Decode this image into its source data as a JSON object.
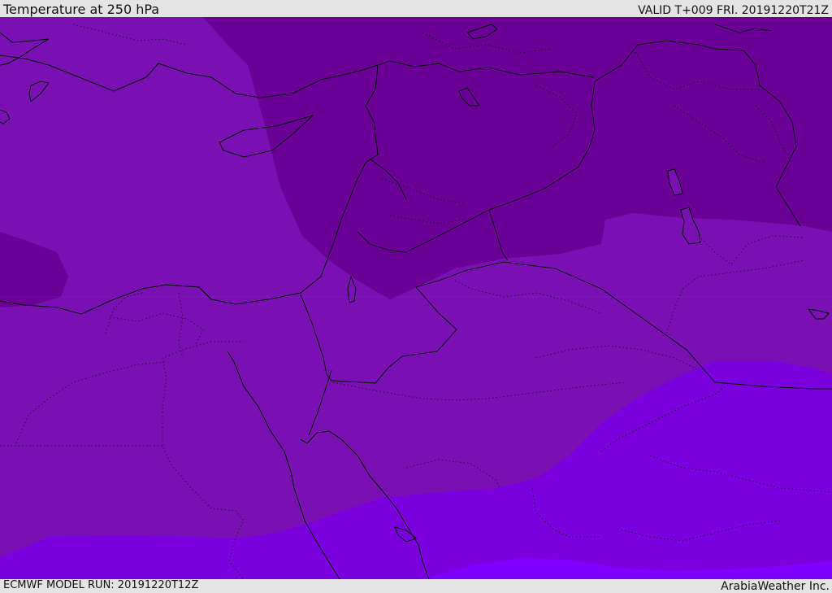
{
  "header": {
    "title": "Temperature at 250 hPa",
    "valid": "VALID T+009 FRI. 20191220T21Z"
  },
  "footer": {
    "model_run": "ECMWF MODEL RUN: 20191220T12Z",
    "brand": "ArabiaWeather Inc."
  },
  "map": {
    "variable": "temperature",
    "level": "250 hPa",
    "band_colors": [
      "#6a0096",
      "#7a10b4",
      "#7b00de",
      "#8000ff"
    ]
  }
}
